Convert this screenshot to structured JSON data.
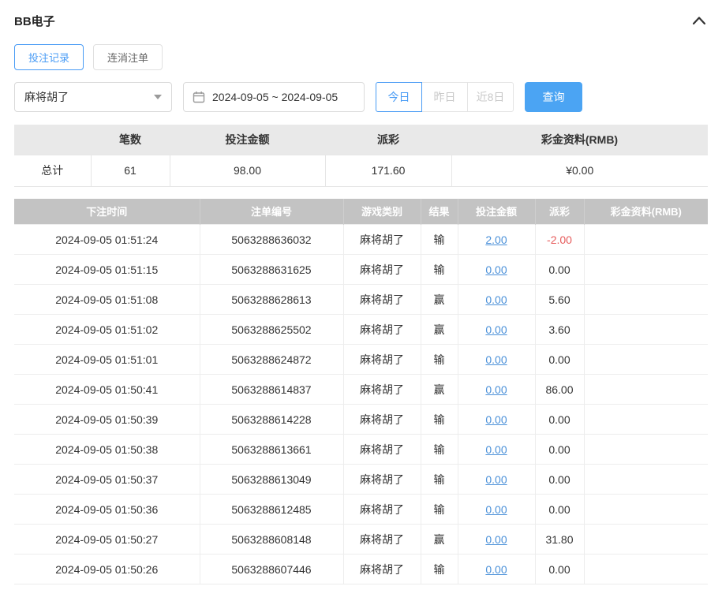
{
  "header": {
    "title": "BB电子"
  },
  "tabs": [
    {
      "label": "投注记录",
      "active": true
    },
    {
      "label": "连消注单",
      "active": false
    }
  ],
  "filters": {
    "game_select": {
      "value": "麻将胡了"
    },
    "date_range": {
      "value": "2024-09-05 ~ 2024-09-05"
    },
    "quick": [
      {
        "label": "今日",
        "active": true
      },
      {
        "label": "昨日",
        "active": false
      },
      {
        "label": "近8日",
        "active": false
      }
    ],
    "search_button": "查询"
  },
  "summary": {
    "headers": [
      "",
      "笔数",
      "投注金额",
      "派彩",
      "彩金资料(RMB)"
    ],
    "total": {
      "label": "总计",
      "count": "61",
      "bet_amount": "98.00",
      "payout": "171.60",
      "jackpot": "¥0.00"
    }
  },
  "table": {
    "headers": [
      "下注时间",
      "注单编号",
      "游戏类别",
      "结果",
      "投注金额",
      "派彩",
      "彩金资料(RMB)"
    ],
    "rows": [
      {
        "time": "2024-09-05 01:51:24",
        "order": "5063288636032",
        "game": "麻将胡了",
        "result": "输",
        "bet": "2.00",
        "payout": "-2.00",
        "jackpot": ""
      },
      {
        "time": "2024-09-05 01:51:15",
        "order": "5063288631625",
        "game": "麻将胡了",
        "result": "输",
        "bet": "0.00",
        "payout": "0.00",
        "jackpot": ""
      },
      {
        "time": "2024-09-05 01:51:08",
        "order": "5063288628613",
        "game": "麻将胡了",
        "result": "赢",
        "bet": "0.00",
        "payout": "5.60",
        "jackpot": ""
      },
      {
        "time": "2024-09-05 01:51:02",
        "order": "5063288625502",
        "game": "麻将胡了",
        "result": "赢",
        "bet": "0.00",
        "payout": "3.60",
        "jackpot": ""
      },
      {
        "time": "2024-09-05 01:51:01",
        "order": "5063288624872",
        "game": "麻将胡了",
        "result": "输",
        "bet": "0.00",
        "payout": "0.00",
        "jackpot": ""
      },
      {
        "time": "2024-09-05 01:50:41",
        "order": "5063288614837",
        "game": "麻将胡了",
        "result": "赢",
        "bet": "0.00",
        "payout": "86.00",
        "jackpot": ""
      },
      {
        "time": "2024-09-05 01:50:39",
        "order": "5063288614228",
        "game": "麻将胡了",
        "result": "输",
        "bet": "0.00",
        "payout": "0.00",
        "jackpot": ""
      },
      {
        "time": "2024-09-05 01:50:38",
        "order": "5063288613661",
        "game": "麻将胡了",
        "result": "输",
        "bet": "0.00",
        "payout": "0.00",
        "jackpot": ""
      },
      {
        "time": "2024-09-05 01:50:37",
        "order": "5063288613049",
        "game": "麻将胡了",
        "result": "输",
        "bet": "0.00",
        "payout": "0.00",
        "jackpot": ""
      },
      {
        "time": "2024-09-05 01:50:36",
        "order": "5063288612485",
        "game": "麻将胡了",
        "result": "输",
        "bet": "0.00",
        "payout": "0.00",
        "jackpot": ""
      },
      {
        "time": "2024-09-05 01:50:27",
        "order": "5063288608148",
        "game": "麻将胡了",
        "result": "赢",
        "bet": "0.00",
        "payout": "31.80",
        "jackpot": ""
      },
      {
        "time": "2024-09-05 01:50:26",
        "order": "5063288607446",
        "game": "麻将胡了",
        "result": "输",
        "bet": "0.00",
        "payout": "0.00",
        "jackpot": ""
      }
    ]
  },
  "colors": {
    "accent": "#4a9cf5",
    "link": "#4a90d9",
    "negative": "#e65b5b",
    "table_header_bg": "#c3c3c3",
    "summary_header_bg": "#e9e9e9"
  }
}
